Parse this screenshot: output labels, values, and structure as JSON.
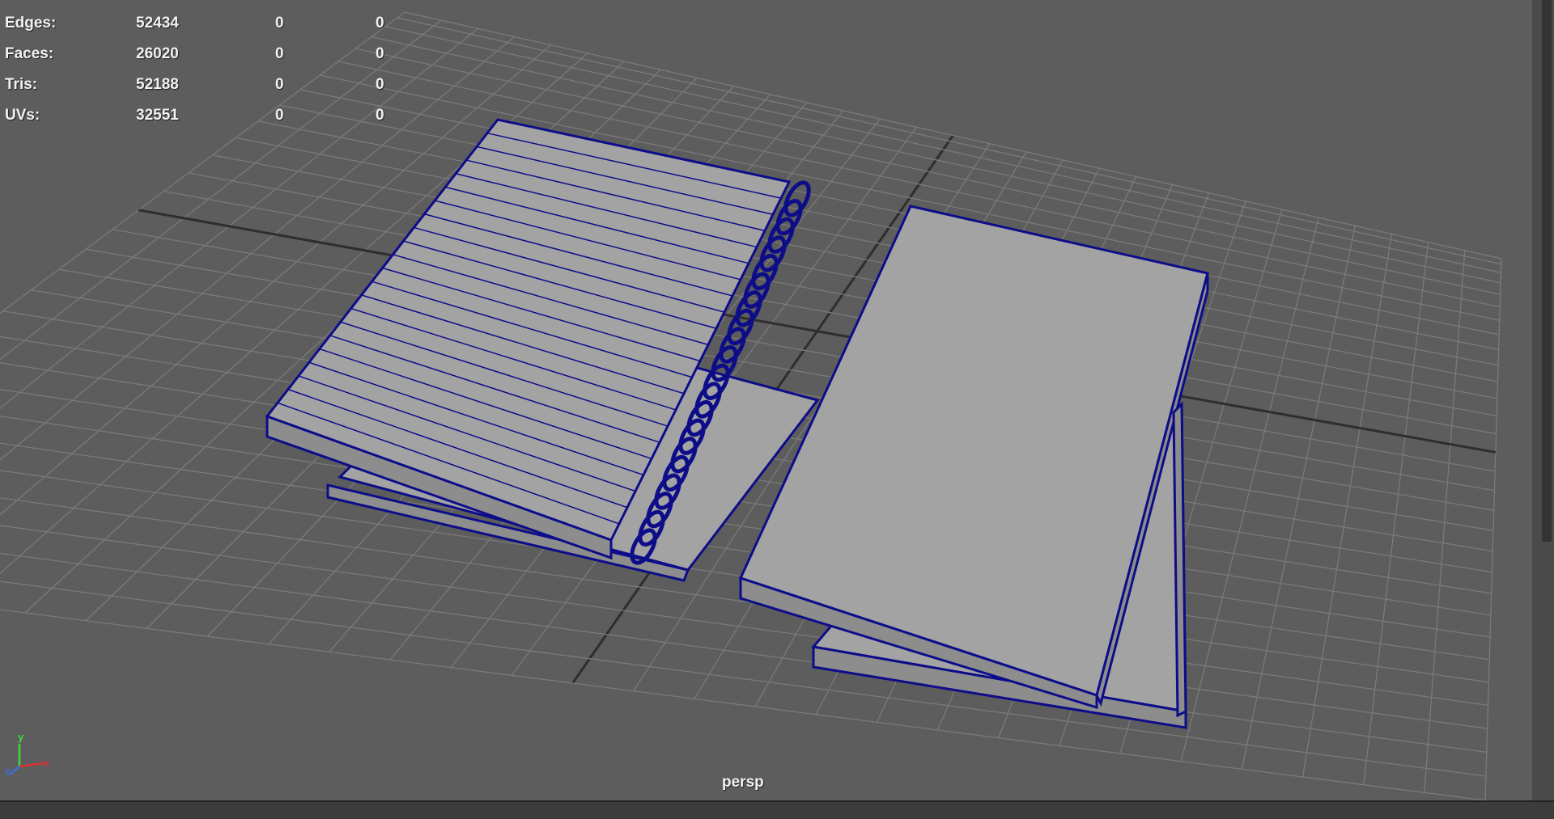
{
  "hud": {
    "rows": [
      {
        "label": "Edges:",
        "v1": "52434",
        "v2": "0",
        "v3": "0"
      },
      {
        "label": "Faces:",
        "v1": "26020",
        "v2": "0",
        "v3": "0"
      },
      {
        "label": "Tris:",
        "v1": "52188",
        "v2": "0",
        "v3": "0"
      },
      {
        "label": "UVs:",
        "v1": "32551",
        "v2": "0",
        "v3": "0"
      }
    ]
  },
  "viewport": {
    "camera": "persp"
  },
  "gizmo": {
    "y_label": "y",
    "x_label": "x",
    "z_label": "z",
    "y_color": "#3cdc3c",
    "x_color": "#dc3232",
    "z_color": "#3c6edc"
  },
  "colors": {
    "wireframe": "#0d0d8a",
    "surface": "#a3a3a3",
    "grid": "#7a7a7a",
    "grid_axis": "#2e2e2e",
    "background": "#5d5d5d"
  }
}
